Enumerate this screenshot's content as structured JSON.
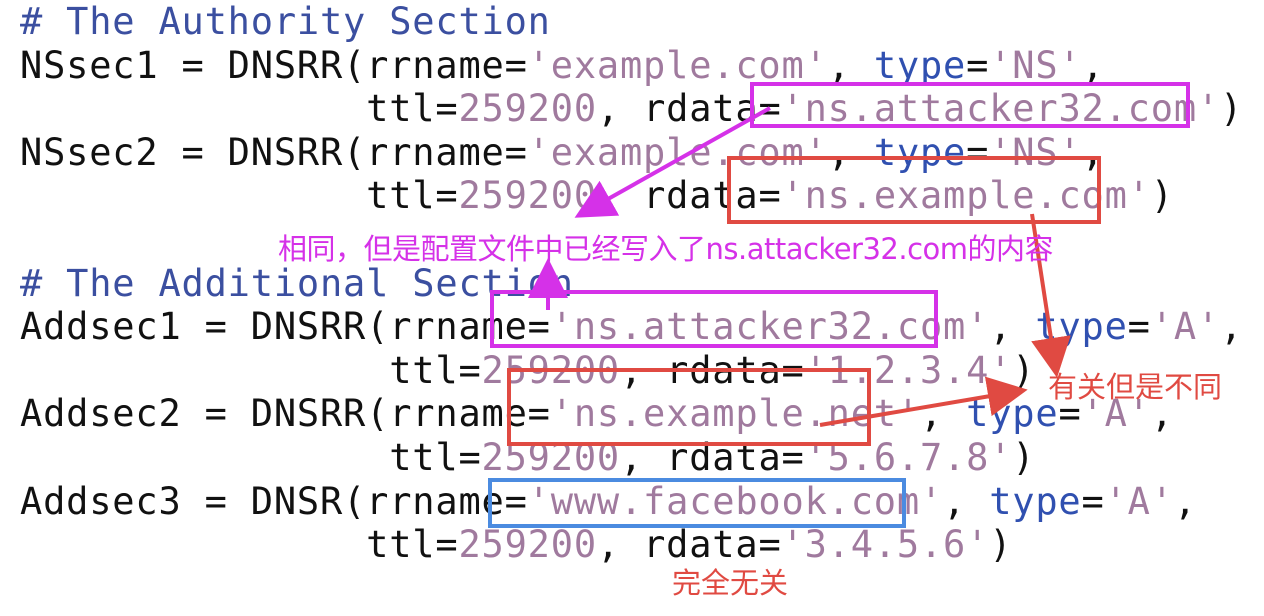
{
  "code_lines": [
    [
      {
        "cls": "cm",
        "t": "# The Authority Section"
      }
    ],
    [
      {
        "cls": "ident",
        "t": "NSsec1 = DNSRR("
      },
      {
        "cls": "ident",
        "t": "rrname="
      },
      {
        "cls": "str",
        "t": "'example.com'"
      },
      {
        "cls": "pun",
        "t": ", "
      },
      {
        "cls": "kw",
        "t": "type"
      },
      {
        "cls": "pun",
        "t": "="
      },
      {
        "cls": "str",
        "t": "'NS'"
      },
      {
        "cls": "pun",
        "t": ","
      }
    ],
    [
      {
        "cls": "ident",
        "t": "               ttl="
      },
      {
        "cls": "num",
        "t": "259200"
      },
      {
        "cls": "pun",
        "t": ", rdata="
      },
      {
        "cls": "str",
        "t": "'ns.attacker32.com'"
      },
      {
        "cls": "pun",
        "t": ")"
      }
    ],
    [
      {
        "cls": "ident",
        "t": "NSsec2 = DNSRR("
      },
      {
        "cls": "ident",
        "t": "rrname="
      },
      {
        "cls": "str",
        "t": "'example.com'"
      },
      {
        "cls": "pun",
        "t": ", "
      },
      {
        "cls": "kw",
        "t": "type"
      },
      {
        "cls": "pun",
        "t": "="
      },
      {
        "cls": "str",
        "t": "'NS'"
      },
      {
        "cls": "pun",
        "t": ","
      }
    ],
    [
      {
        "cls": "ident",
        "t": "               ttl="
      },
      {
        "cls": "num",
        "t": "259200"
      },
      {
        "cls": "pun",
        "t": ", rdata="
      },
      {
        "cls": "str",
        "t": "'ns.example.com'"
      },
      {
        "cls": "pun",
        "t": ")"
      }
    ],
    [
      {
        "cls": "ident",
        "t": " "
      }
    ],
    [
      {
        "cls": "cm",
        "t": "# The Additional Section"
      }
    ],
    [
      {
        "cls": "ident",
        "t": "Addsec1 = DNSRR("
      },
      {
        "cls": "ident",
        "t": "rrname="
      },
      {
        "cls": "str",
        "t": "'ns.attacker32.com'"
      },
      {
        "cls": "pun",
        "t": ", "
      },
      {
        "cls": "kw",
        "t": "type"
      },
      {
        "cls": "pun",
        "t": "="
      },
      {
        "cls": "str",
        "t": "'A'"
      },
      {
        "cls": "pun",
        "t": ","
      }
    ],
    [
      {
        "cls": "ident",
        "t": "                ttl="
      },
      {
        "cls": "num",
        "t": "259200"
      },
      {
        "cls": "pun",
        "t": ", rdata="
      },
      {
        "cls": "str",
        "t": "'1.2.3.4'"
      },
      {
        "cls": "pun",
        "t": ")"
      }
    ],
    [
      {
        "cls": "ident",
        "t": "Addsec2 = DNSRR("
      },
      {
        "cls": "ident",
        "t": "rrname="
      },
      {
        "cls": "str",
        "t": "'ns.example.net'"
      },
      {
        "cls": "pun",
        "t": ", "
      },
      {
        "cls": "kw",
        "t": "type"
      },
      {
        "cls": "pun",
        "t": "="
      },
      {
        "cls": "str",
        "t": "'A'"
      },
      {
        "cls": "pun",
        "t": ","
      }
    ],
    [
      {
        "cls": "ident",
        "t": "                ttl="
      },
      {
        "cls": "num",
        "t": "259200"
      },
      {
        "cls": "pun",
        "t": ", rdata="
      },
      {
        "cls": "str",
        "t": "'5.6.7.8'"
      },
      {
        "cls": "pun",
        "t": ")"
      }
    ],
    [
      {
        "cls": "ident",
        "t": "Addsec3 = DNSR("
      },
      {
        "cls": "ident",
        "t": "rrname="
      },
      {
        "cls": "str",
        "t": "'www.facebook.com'"
      },
      {
        "cls": "pun",
        "t": ", "
      },
      {
        "cls": "kw",
        "t": "type"
      },
      {
        "cls": "pun",
        "t": "="
      },
      {
        "cls": "str",
        "t": "'A'"
      },
      {
        "cls": "pun",
        "t": ","
      }
    ],
    [
      {
        "cls": "ident",
        "t": "               ttl="
      },
      {
        "cls": "num",
        "t": "259200"
      },
      {
        "cls": "pun",
        "t": ", rdata="
      },
      {
        "cls": "str",
        "t": "'3.4.5.6'"
      },
      {
        "cls": "pun",
        "t": ")"
      }
    ]
  ],
  "annotations": {
    "same_note": "相同，但是配置文件中已经写入了ns.attacker32.com的内容",
    "related_note": "有关但是不同",
    "unrelated_note": "完全无关"
  },
  "colors": {
    "magenta": "#d531e8",
    "red": "#e04a42",
    "blue": "#4b8be0"
  }
}
